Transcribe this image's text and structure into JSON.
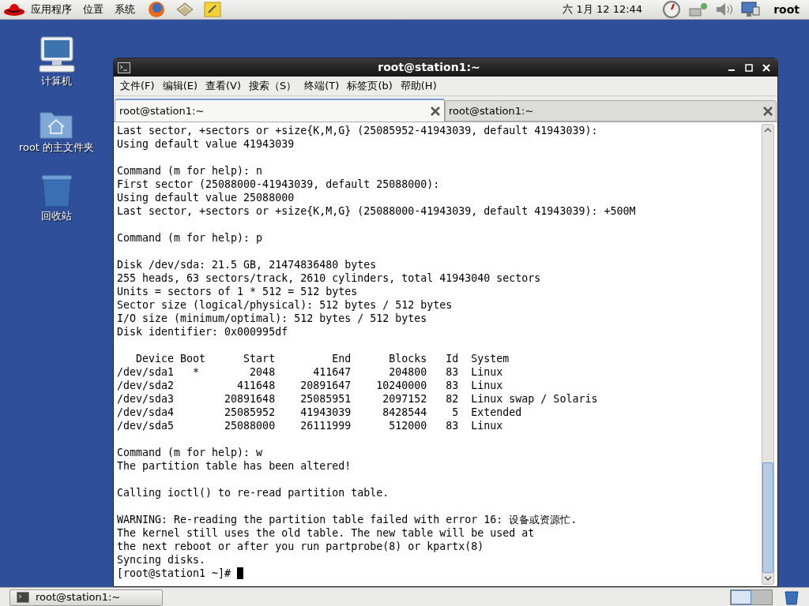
{
  "top_panel": {
    "menus": [
      "应用程序",
      "位置",
      "系统"
    ],
    "clock": "六 1月 12 12:44",
    "user": "root"
  },
  "desktop_icons": [
    {
      "kind": "computer",
      "label": "计算机"
    },
    {
      "kind": "home",
      "label": "root 的主文件夹"
    },
    {
      "kind": "trash",
      "label": "回收站"
    }
  ],
  "window": {
    "title": "root@station1:~",
    "menu": [
      "文件(F)",
      "编辑(E)",
      "查看(V)",
      "搜索（S）",
      "终端(T)",
      "标签页(b)",
      "帮助(H)"
    ],
    "tabs": [
      {
        "label": "root@station1:~",
        "selected": true
      },
      {
        "label": "root@station1:~",
        "selected": false
      }
    ],
    "terminal_blocks": [
      [
        "Last sector, +sectors or +size{K,M,G} (25085952-41943039, default 41943039):",
        "Using default value 41943039"
      ],
      [
        "Command (m for help): n",
        "First sector (25088000-41943039, default 25088000):",
        "Using default value 25088000",
        "Last sector, +sectors or +size{K,M,G} (25088000-41943039, default 41943039): +500M"
      ],
      [
        "Command (m for help): p"
      ],
      [
        "Disk /dev/sda: 21.5 GB, 21474836480 bytes",
        "255 heads, 63 sectors/track, 2610 cylinders, total 41943040 sectors",
        "Units = sectors of 1 * 512 = 512 bytes",
        "Sector size (logical/physical): 512 bytes / 512 bytes",
        "I/O size (minimum/optimal): 512 bytes / 512 bytes",
        "Disk identifier: 0x000995df"
      ],
      [
        "   Device Boot      Start         End      Blocks   Id  System",
        "/dev/sda1   *        2048      411647      204800   83  Linux",
        "/dev/sda2          411648    20891647    10240000   83  Linux",
        "/dev/sda3        20891648    25085951     2097152   82  Linux swap / Solaris",
        "/dev/sda4        25085952    41943039     8428544    5  Extended",
        "/dev/sda5        25088000    26111999      512000   83  Linux"
      ],
      [
        "Command (m for help): w",
        "The partition table has been altered!"
      ],
      [
        "Calling ioctl() to re-read partition table."
      ],
      [
        "WARNING: Re-reading the partition table failed with error 16: 设备或资源忙.",
        "The kernel still uses the old table. The new table will be used at",
        "the next reboot or after you run partprobe(8) or kpartx(8)",
        "Syncing disks."
      ]
    ],
    "prompt": "[root@station1 ~]#"
  },
  "taskbar": {
    "tasks": [
      {
        "label": "root@station1:~",
        "selected": false
      }
    ]
  }
}
